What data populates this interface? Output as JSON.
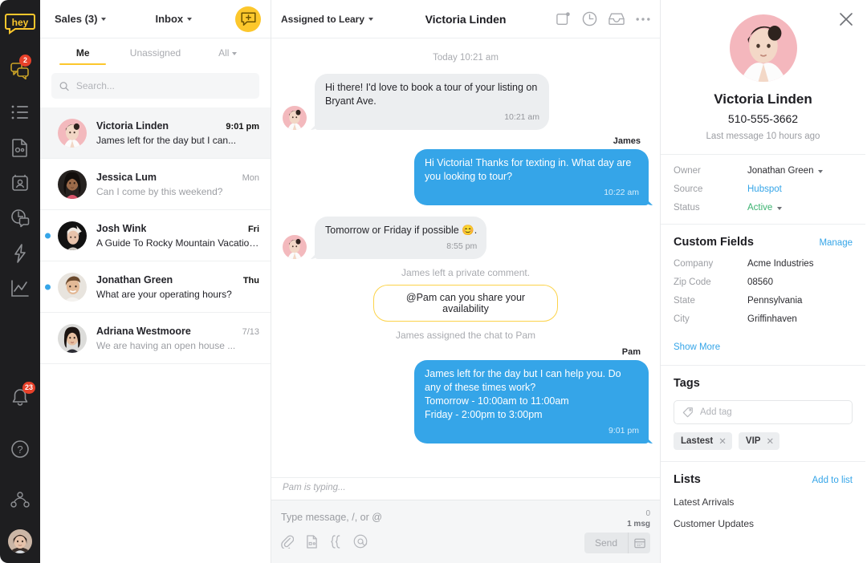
{
  "rail": {
    "logo_text": "hey",
    "icons": [
      {
        "name": "chats-icon",
        "badge": "2"
      },
      {
        "name": "list-icon",
        "badge": ""
      },
      {
        "name": "document-icon",
        "badge": ""
      },
      {
        "name": "contacts-icon",
        "badge": ""
      },
      {
        "name": "support-chat-icon",
        "badge": ""
      },
      {
        "name": "automation-icon",
        "badge": ""
      },
      {
        "name": "analytics-icon",
        "badge": ""
      }
    ],
    "bottom_icons": [
      {
        "name": "notifications-icon",
        "badge": "23"
      },
      {
        "name": "help-icon",
        "badge": ""
      },
      {
        "name": "team-icon",
        "badge": ""
      }
    ]
  },
  "list": {
    "inbox_selector": "Sales (3)",
    "folder_selector": "Inbox",
    "compose_label": "new-message",
    "tabs": [
      {
        "label": "Me",
        "active": true,
        "caret": false
      },
      {
        "label": "Unassigned",
        "active": false,
        "caret": false
      },
      {
        "label": "All",
        "active": false,
        "caret": true
      }
    ],
    "search_placeholder": "Search...",
    "search_value": "",
    "conversations": [
      {
        "name": "Victoria Linden",
        "time": "9:01 pm",
        "preview": "James left for the day but I can...",
        "selected": true,
        "unread": false,
        "bold_time": true,
        "bold_preview": true
      },
      {
        "name": "Jessica Lum",
        "time": "Mon",
        "preview": "Can I come by this weekend?",
        "selected": false,
        "unread": false,
        "bold_time": false,
        "bold_preview": false
      },
      {
        "name": "Josh Wink",
        "time": "Fri",
        "preview": "A Guide To Rocky Mountain Vacations...",
        "selected": false,
        "unread": true,
        "bold_time": true,
        "bold_preview": true
      },
      {
        "name": "Jonathan Green",
        "time": "Thu",
        "preview": "What are your operating hours?",
        "selected": false,
        "unread": true,
        "bold_time": true,
        "bold_preview": true
      },
      {
        "name": "Adriana Westmoore",
        "time": "7/13",
        "preview": "We are having an open house ...",
        "selected": false,
        "unread": false,
        "bold_time": false,
        "bold_preview": false
      }
    ]
  },
  "thread": {
    "assigned_label": "Assigned to Leary",
    "title": "Victoria Linden",
    "actions": [
      {
        "name": "tasks-icon"
      },
      {
        "name": "snooze-clock-icon"
      },
      {
        "name": "archive-inbox-icon"
      },
      {
        "name": "more-options-icon"
      }
    ],
    "daystamp": "Today 10:21 am",
    "messages": [
      {
        "kind": "in",
        "text": "Hi there! I'd love to book a tour of your listing on Bryant Ave.",
        "time": "10:21 am",
        "avatar": true
      },
      {
        "kind": "sender",
        "text": "James"
      },
      {
        "kind": "out",
        "text": "Hi Victoria! Thanks for texting in. What day are you looking to tour?",
        "time": "10:22 am"
      },
      {
        "kind": "in",
        "text": "Tomorrow or Friday if possible 😊.",
        "time": "8:55 pm",
        "avatar": true
      },
      {
        "kind": "system",
        "text": "James left a private comment."
      },
      {
        "kind": "note",
        "text": "@Pam can you share your availability"
      },
      {
        "kind": "system",
        "text": "James assigned the chat to Pam"
      },
      {
        "kind": "sender",
        "text": "Pam"
      },
      {
        "kind": "out",
        "text": "James left for the day but I can help you. Do any of these times work?\nTomorrow - 10:00am to 11:00am\nFriday - 2:00pm to 3:00pm",
        "time": "9:01 pm"
      }
    ],
    "typing_status": "Pam is typing...",
    "composer_placeholder": "Type message, /, or @",
    "composer_value": "",
    "char_count": "0",
    "msg_count": "1 msg",
    "send_label": "Send",
    "composer_tools": [
      {
        "name": "attachment-icon"
      },
      {
        "name": "template-icon"
      },
      {
        "name": "merge-field-icon"
      },
      {
        "name": "mention-icon"
      }
    ],
    "schedule_icon": "calendar-icon"
  },
  "detail": {
    "close_label": "close-panel",
    "name": "Victoria Linden",
    "phone": "510-555-3662",
    "last_message": "Last message 10 hours ago",
    "fields": [
      {
        "label": "Owner",
        "value": "Jonathan Green",
        "style": "plain",
        "caret": true
      },
      {
        "label": "Source",
        "value": "Hubspot",
        "style": "link",
        "caret": false
      },
      {
        "label": "Status",
        "value": "Active",
        "style": "green",
        "caret": true
      }
    ],
    "custom_fields_title": "Custom Fields",
    "manage_label": "Manage",
    "custom_fields": [
      {
        "label": "Company",
        "value": "Acme Industries"
      },
      {
        "label": "Zip Code",
        "value": "08560"
      },
      {
        "label": "State",
        "value": "Pennsylvania"
      },
      {
        "label": "City",
        "value": "Griffinhaven"
      }
    ],
    "show_more_label": "Show More",
    "tags_title": "Tags",
    "tag_placeholder": "Add tag",
    "tags": [
      "Lastest",
      "VIP"
    ],
    "lists_title": "Lists",
    "add_to_list_label": "Add to list",
    "lists": [
      "Latest Arrivals",
      "Customer Updates"
    ]
  },
  "colors": {
    "brand_yellow": "#fcc72c",
    "accent_blue": "#35a5e8",
    "status_green": "#3cb371",
    "badge_red": "#e8412a",
    "rail_dark": "#1e1e20"
  }
}
